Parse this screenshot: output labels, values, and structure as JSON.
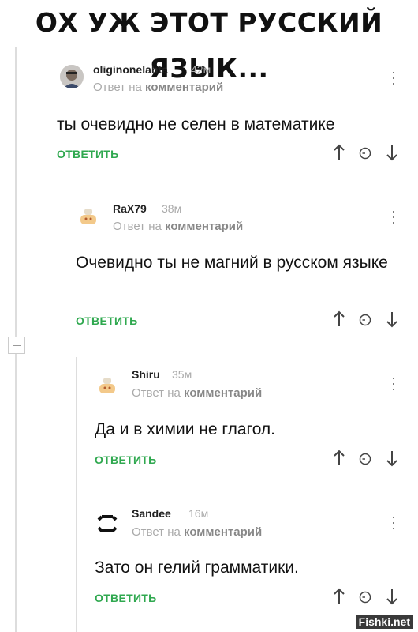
{
  "header": {
    "title": "ОХ УЖ ЭТОТ РУССКИЙ ЯЗЫК..."
  },
  "reply_to_prefix": "Ответ на",
  "reply_to_target": "комментарий",
  "answer_label": "ОТВЕТИТЬ",
  "accent_color": "#2fa84f",
  "comments": [
    {
      "user": "oliginonelahta",
      "time": "42м",
      "text": "ты очевидно не селен в математике"
    },
    {
      "user": "RaX79",
      "time": "38м",
      "text": "Очевидно ты не магний в русском языке"
    },
    {
      "user": "Shiru",
      "time": "35м",
      "text": "Да и в химии не глагол."
    },
    {
      "user": "Sandee",
      "time": "16м",
      "text": "Зато он гелий грамматики."
    }
  ],
  "watermark": "Fishki.net"
}
